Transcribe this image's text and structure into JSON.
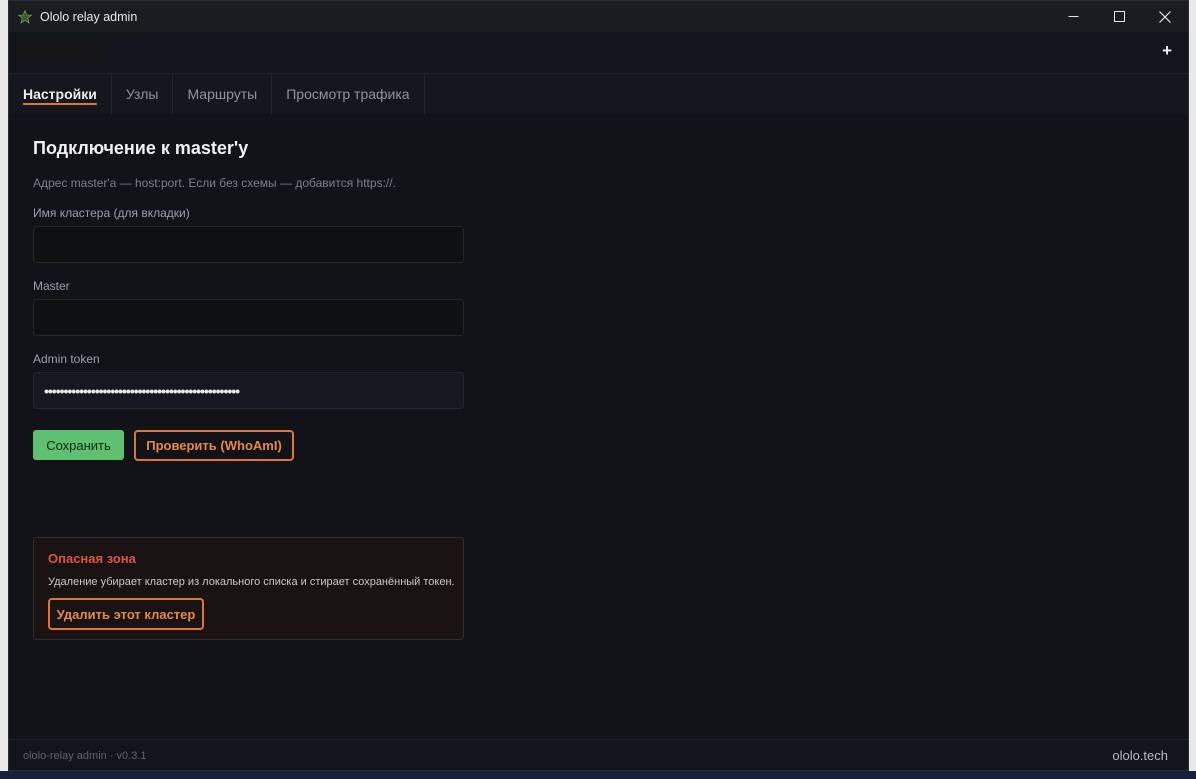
{
  "window": {
    "title": "Ololo relay admin",
    "controls": {
      "minimize": "—",
      "maximize": "☐",
      "close": "✕"
    }
  },
  "topbar": {
    "add_cluster": "+"
  },
  "tabs": [
    {
      "label": "Настройки",
      "active": true
    },
    {
      "label": "Узлы",
      "active": false
    },
    {
      "label": "Маршруты",
      "active": false
    },
    {
      "label": "Просмотр трафика",
      "active": false
    }
  ],
  "settings": {
    "heading": "Подключение к master'у",
    "hint": "Адрес master'а — host:port. Если без схемы — добавится https://.",
    "cluster_name": {
      "label": "Имя кластера (для вкладки)",
      "value": ""
    },
    "master": {
      "label": "Master",
      "value": ""
    },
    "token": {
      "label": "Admin token",
      "value": "••••••••••••••••••••••••••••••••••••••••••••••••••"
    },
    "save_button": "Сохранить",
    "check_button": "Проверить (WhoAmI)"
  },
  "danger_zone": {
    "title": "Опасная зона",
    "text": "Удаление убирает кластер из локального списка и стирает сохранённый токен.",
    "delete_button": "Удалить этот кластер"
  },
  "footer": {
    "version": "ololo-relay admin · v0.3.1",
    "brand": "ololo.tech"
  },
  "colors": {
    "accent": "#e0772e",
    "save": "#5ec070",
    "danger": "#e0553e",
    "background": "#111318"
  }
}
